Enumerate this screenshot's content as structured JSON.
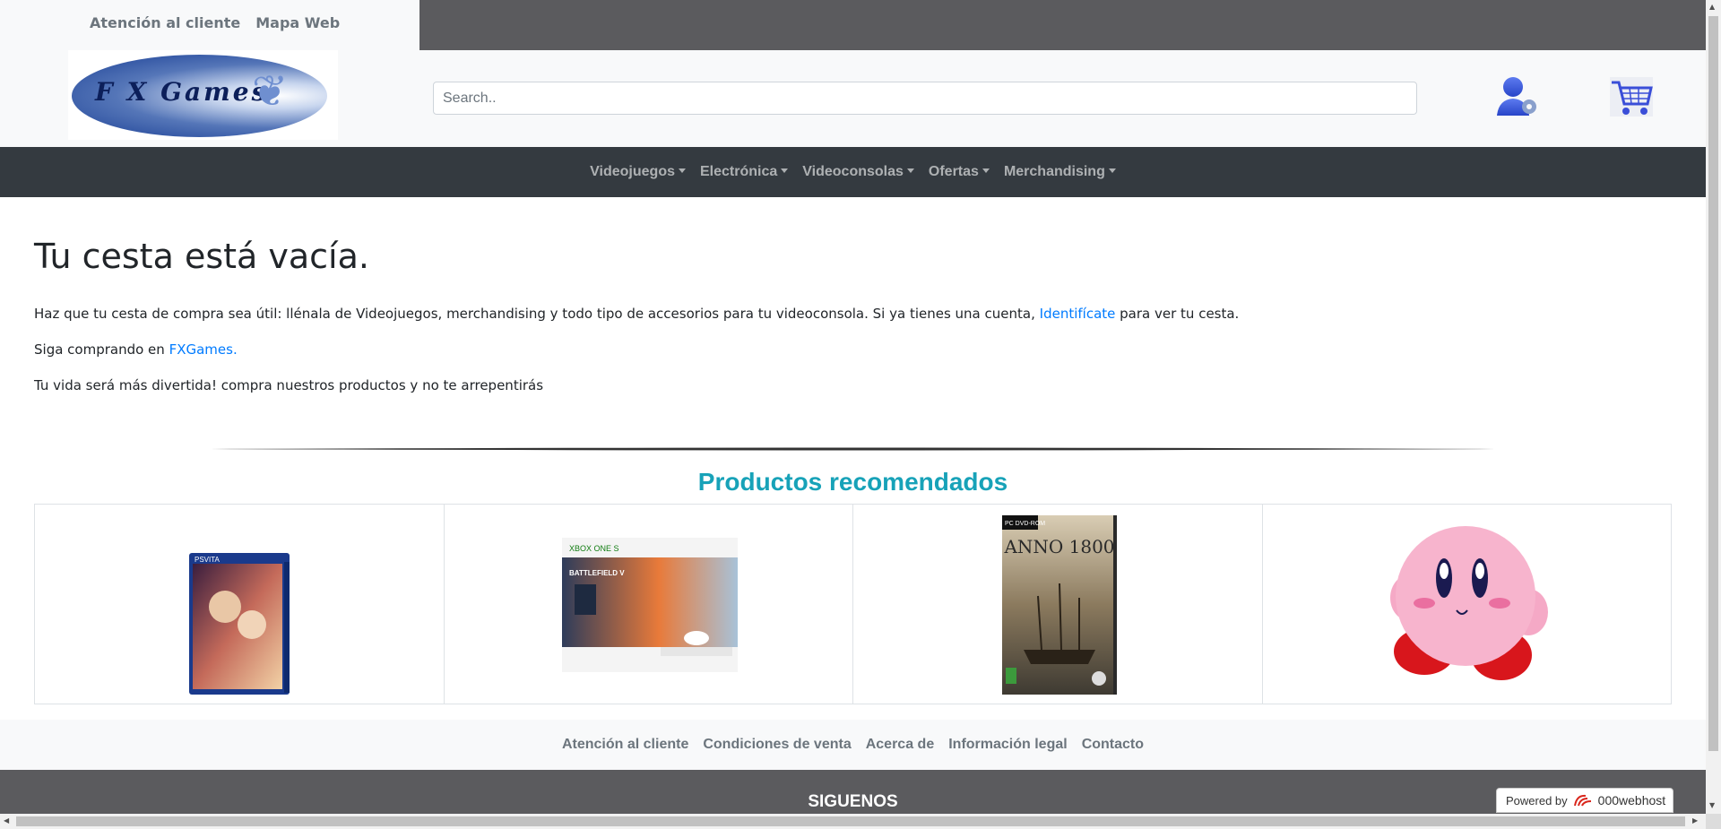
{
  "header": {
    "top_links": [
      "Atención al cliente",
      "Mapa Web"
    ],
    "logo_text": "FX Games",
    "search_placeholder": "Search..",
    "user_icon": "user-settings-icon",
    "cart_icon": "shopping-cart-icon"
  },
  "nav": {
    "items": [
      "Videojuegos",
      "Electrónica",
      "Videoconsolas",
      "Ofertas",
      "Merchandising"
    ]
  },
  "main": {
    "title": "Tu cesta está vacía.",
    "p1_before": "Haz que tu cesta de compra sea útil: llénala de Videojuegos, merchandising y todo tipo de accesorios para tu videoconsola. Si ya tienes una cuenta,",
    "p1_link": "Identifícate",
    "p1_after": "para ver tu cesta.",
    "p2_before": "Siga comprando en",
    "p2_link": "FXGames.",
    "p3": "Tu vida será más divertida! compra nuestros productos y no te arrepentirás"
  },
  "recommended": {
    "title": "Productos recomendados",
    "products": [
      {
        "name": "ps-vita-game",
        "badge": "PSVITA"
      },
      {
        "name": "xbox-one-s-battlefield-v",
        "badge": "XBOX ONE S",
        "label": "BATTLEFIELD V"
      },
      {
        "name": "anno-1800-pc",
        "badge": "PC DVD-ROM",
        "label": "ANNO 1800"
      },
      {
        "name": "kirby-plush"
      }
    ]
  },
  "footer": {
    "links": [
      "Atención al cliente",
      "Condiciones de venta",
      "Acerca de",
      "Información legal",
      "Contacto"
    ],
    "siguenos": "SIGUENOS",
    "powered_by": "Powered by",
    "host": "000webhost"
  },
  "colors": {
    "nav_bg": "#343a40",
    "accent": "#17a2b8",
    "link": "#007bff",
    "dark_band": "#5b5b5e"
  }
}
